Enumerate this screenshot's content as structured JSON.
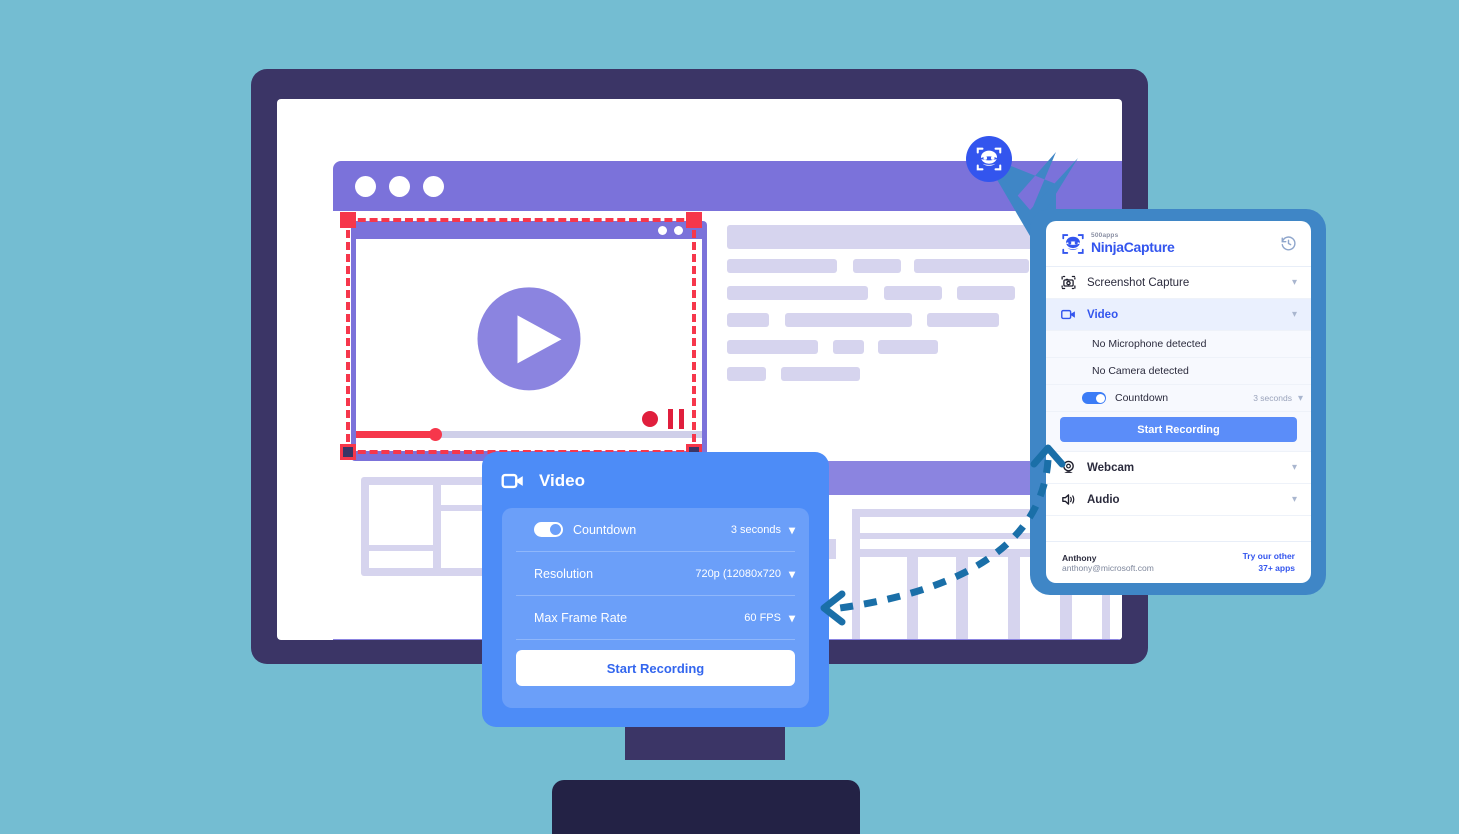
{
  "theme": {
    "background": "#74bdd2",
    "monitor_frame": "#3b3566",
    "monitor_base": "#232245",
    "browser_accent": "#7b72da",
    "marquee": "#f6374b",
    "brand_blue": "#3355ee",
    "panel_blue": "#3f86c6",
    "card_blue": "#4d8cf7",
    "card_inner_blue": "#6b9ff9"
  },
  "browser_mock": {
    "window_dots": 3,
    "play_button": "play-icon",
    "record_button": "record-dot-icon",
    "pause_button": "pause-icon"
  },
  "ninja_panel": {
    "logo": {
      "tagline": "500apps",
      "name": "NinjaCapture",
      "icon": "ninja-logo-icon"
    },
    "history_icon": "history-clock-icon",
    "items": [
      {
        "label": "Screenshot Capture",
        "icon": "screenshot-camera-icon",
        "active": false
      },
      {
        "label": "Video",
        "icon": "video-camera-icon",
        "active": true
      }
    ],
    "video_subitems": [
      {
        "label": "No Microphone detected"
      },
      {
        "label": "No Camera detected"
      }
    ],
    "countdown": {
      "label": "Countdown",
      "value": "3 seconds",
      "enabled": true,
      "chevron": "chevron-down-icon"
    },
    "start_recording_label": "Start Recording",
    "more_items": [
      {
        "label": "Webcam",
        "icon": "webcam-icon"
      },
      {
        "label": "Audio",
        "icon": "audio-speaker-icon"
      }
    ],
    "footer": {
      "user_name": "Anthony",
      "user_email": "anthony@microsoft.com",
      "promo_line1": "Try our other",
      "promo_line2": "37+ apps"
    }
  },
  "video_card": {
    "title": "Video",
    "title_icon": "video-camera-icon",
    "rows": [
      {
        "label": "Countdown",
        "value": "3 seconds",
        "toggle": true,
        "chevron": "chevron-down-icon"
      },
      {
        "label": "Resolution",
        "value": "720p (12080x720",
        "toggle": false,
        "chevron": "chevron-down-icon"
      },
      {
        "label": "Max Frame Rate",
        "value": "60 FPS",
        "toggle": false,
        "chevron": "chevron-down-icon"
      }
    ],
    "start_recording_label": "Start Recording"
  }
}
